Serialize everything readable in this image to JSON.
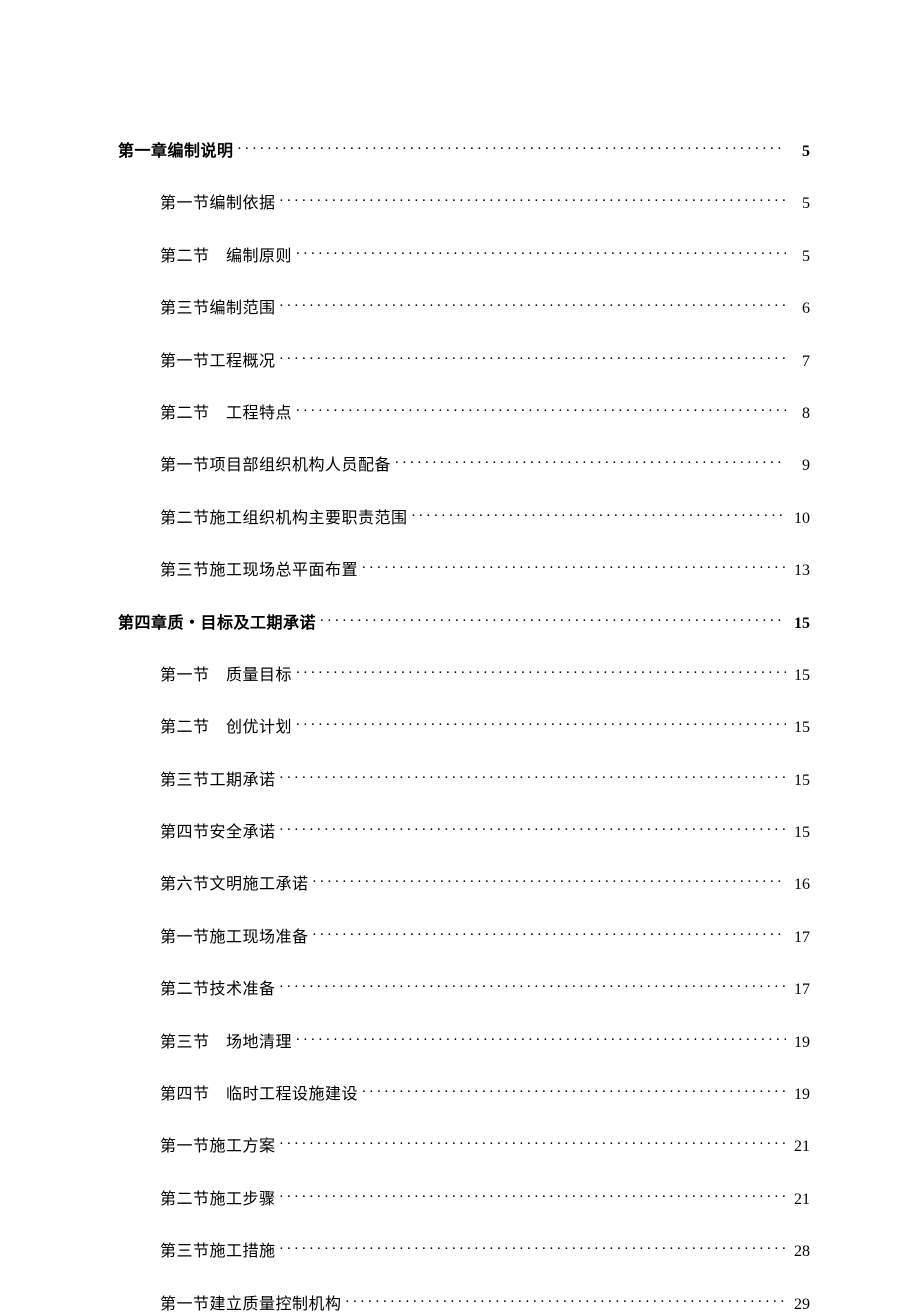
{
  "toc": [
    {
      "level": 0,
      "bold": true,
      "label": "第一章编制说明",
      "page": "5"
    },
    {
      "level": 1,
      "bold": false,
      "label": "第一节编制依据",
      "page": "5"
    },
    {
      "level": 1,
      "bold": false,
      "label": "第二节　编制原则",
      "page": "5"
    },
    {
      "level": 1,
      "bold": false,
      "label": "第三节编制范围",
      "page": "6"
    },
    {
      "level": 1,
      "bold": false,
      "label": "第一节工程概况",
      "page": "7"
    },
    {
      "level": 1,
      "bold": false,
      "label": "第二节　工程特点",
      "page": "8"
    },
    {
      "level": 1,
      "bold": false,
      "label": "第一节项目部组织机构人员配备",
      "page": "9"
    },
    {
      "level": 1,
      "bold": false,
      "label": "第二节施工组织机构主要职责范围",
      "page": "10"
    },
    {
      "level": 1,
      "bold": false,
      "label": "第三节施工现场总平面布置",
      "page": "13"
    },
    {
      "level": 0,
      "bold": true,
      "label": "第四章质・目标及工期承诺",
      "page": "15"
    },
    {
      "level": 1,
      "bold": false,
      "label": "第一节　质量目标",
      "page": "15"
    },
    {
      "level": 1,
      "bold": false,
      "label": "第二节　创优计划",
      "page": "15"
    },
    {
      "level": 1,
      "bold": false,
      "label": "第三节工期承诺",
      "page": "15"
    },
    {
      "level": 1,
      "bold": false,
      "label": "第四节安全承诺",
      "page": "15"
    },
    {
      "level": 1,
      "bold": false,
      "label": "第六节文明施工承诺",
      "page": "16"
    },
    {
      "level": 1,
      "bold": false,
      "label": "第一节施工现场准备",
      "page": "17"
    },
    {
      "level": 1,
      "bold": false,
      "label": "第二节技术准备",
      "page": "17"
    },
    {
      "level": 1,
      "bold": false,
      "label": "第三节　场地清理",
      "page": "19"
    },
    {
      "level": 1,
      "bold": false,
      "label": "第四节　临时工程设施建设",
      "page": "19"
    },
    {
      "level": 1,
      "bold": false,
      "label": "第一节施工方案",
      "page": "21"
    },
    {
      "level": 1,
      "bold": false,
      "label": "第二节施工步骤",
      "page": "21"
    },
    {
      "level": 1,
      "bold": false,
      "label": "第三节施工措施",
      "page": "28"
    },
    {
      "level": 1,
      "bold": false,
      "label": "第一节建立质量控制机构",
      "page": "29"
    }
  ]
}
